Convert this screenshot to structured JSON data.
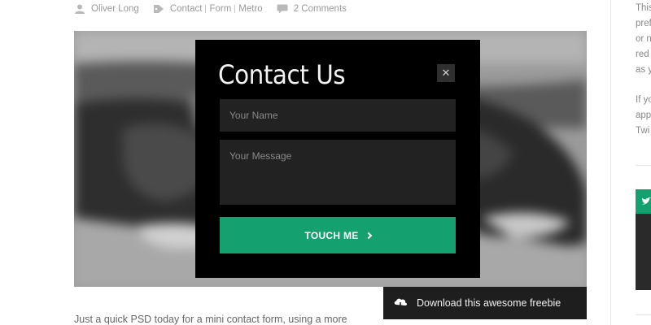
{
  "meta": {
    "author": "Oliver Long",
    "categories": [
      "Contact",
      "Form",
      "Metro"
    ],
    "comments": "2 Comments"
  },
  "modal": {
    "title": "Contact Us",
    "close_label": "✕",
    "name_placeholder": "Your Name",
    "message_placeholder": "Your Message",
    "submit_label": "TOUCH ME"
  },
  "intro_text": "Just a quick PSD today for a mini contact form, using a more",
  "download_label": "Download this awesome freebie",
  "sidebar": {
    "lines_1": [
      "This",
      "pref",
      "or n",
      "red",
      "as y"
    ],
    "lines_2": [
      "If yo",
      "app",
      "Twi"
    ]
  },
  "colors": {
    "accent": "#14a06f",
    "modal_bg": "#000000",
    "field_bg": "#222222",
    "download_bg": "#1e1e1e"
  },
  "icons": {
    "author": "user-icon",
    "categories": "tag-icon",
    "comments": "comment-icon",
    "close": "close-icon",
    "submit": "chevron-right-icon",
    "download": "cloud-download-icon",
    "sidebar": "twitter-icon"
  }
}
